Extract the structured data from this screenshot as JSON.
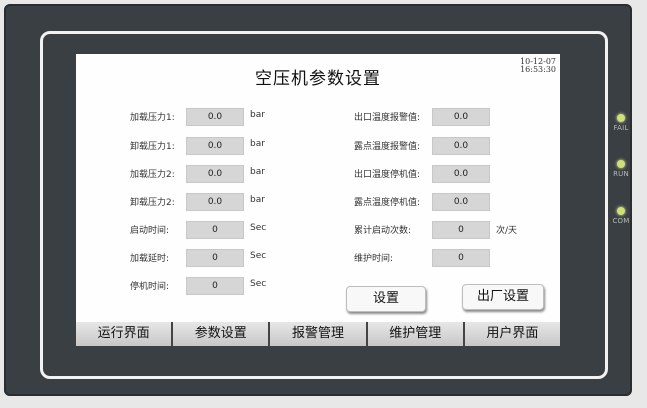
{
  "screen": {
    "title": "空压机参数设置",
    "datetime": {
      "date": "10-12-07",
      "time": "16:53:30"
    }
  },
  "left_params": [
    {
      "label": "加载压力1:",
      "value": "0.0",
      "unit": "bar"
    },
    {
      "label": "卸载压力1:",
      "value": "0.0",
      "unit": "bar"
    },
    {
      "label": "加载压力2:",
      "value": "0.0",
      "unit": "bar"
    },
    {
      "label": "卸载压力2:",
      "value": "0.0",
      "unit": "bar"
    },
    {
      "label": "启动时间:",
      "value": "0",
      "unit": "Sec"
    },
    {
      "label": "加载延时:",
      "value": "0",
      "unit": "Sec"
    },
    {
      "label": "停机时间:",
      "value": "0",
      "unit": "Sec"
    }
  ],
  "right_params": [
    {
      "label": "出口温度报警值:",
      "value": "0.0",
      "unit": ""
    },
    {
      "label": "露点温度报警值:",
      "value": "0.0",
      "unit": ""
    },
    {
      "label": "出口温度停机值:",
      "value": "0.0",
      "unit": ""
    },
    {
      "label": "露点温度停机值:",
      "value": "0.0",
      "unit": ""
    },
    {
      "label": "累计启动次数:",
      "value": "0",
      "unit": "次/天"
    },
    {
      "label": "维护时间:",
      "value": "0",
      "unit": ""
    }
  ],
  "buttons": {
    "settings": "设置",
    "factory_settings": "出厂设置"
  },
  "nav": [
    "运行界面",
    "参数设置",
    "报警管理",
    "维护管理",
    "用户界面"
  ],
  "leds": [
    "FAIL",
    "RUN",
    "COM"
  ],
  "colors": {
    "bezel": "#3a3f44",
    "screen": "#fefefe",
    "value_box": "#d6d6d6",
    "led": "#cfe07a"
  }
}
